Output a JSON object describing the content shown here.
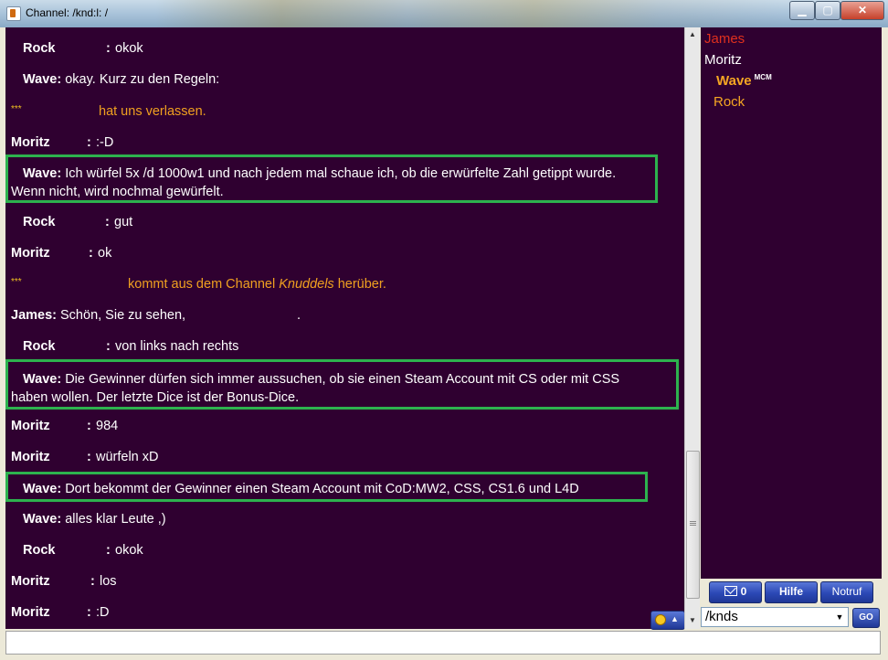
{
  "window": {
    "title": "Channel: /knd:l: /",
    "min": "▁",
    "max": "▢",
    "close": "✕"
  },
  "chat": {
    "messages": [
      {
        "sender": "Rock",
        "sep": ":",
        "text": "okok"
      },
      {
        "sender": "Wave:",
        "sep": "",
        "text": "okay. Kurz zu den Regeln:"
      },
      {
        "stars": "***",
        "text": "hat uns verlassen."
      },
      {
        "sender": "Moritz",
        "sep": ":",
        "text": ":-D"
      },
      {
        "sender": "Wave:",
        "line1": "Ich würfel 5x /d 1000w1 und nach jedem mal schaue ich, ob die erwürfelte Zahl getippt wurde.",
        "line2": "Wenn nicht, wird nochmal gewürfelt."
      },
      {
        "sender": "Rock",
        "sep": ":",
        "text": "gut"
      },
      {
        "sender": "Moritz",
        "sep": ":",
        "text": "ok"
      },
      {
        "stars": "***",
        "pre": "kommt aus dem Channel ",
        "channel": "Knuddels",
        "post": " herüber."
      },
      {
        "sender": "James:",
        "text": "Schön, Sie zu sehen,",
        "tail": "."
      },
      {
        "sender": "Rock",
        "sep": ":",
        "text": "von links nach rechts"
      },
      {
        "sender": "Wave:",
        "line1": "Die Gewinner dürfen sich immer aussuchen, ob sie einen Steam Account mit CS oder mit CSS",
        "line2": "haben wollen. Der letzte Dice ist der Bonus-Dice."
      },
      {
        "sender": "Moritz",
        "sep": ":",
        "text": "984"
      },
      {
        "sender": "Moritz",
        "sep": ":",
        "text": "würfeln xD"
      },
      {
        "sender": "Wave:",
        "text": "Dort bekommt der Gewinner einen Steam Account mit CoD:MW2, CSS, CS1.6 und L4D"
      },
      {
        "sender": "Wave:",
        "text": "alles klar Leute ,)"
      },
      {
        "sender": "Rock",
        "sep": ":",
        "text": "okok"
      },
      {
        "sender": "Moritz",
        "sep": ":",
        "text": "los"
      },
      {
        "sender": "Moritz",
        "sep": ":",
        "text": ":D"
      }
    ]
  },
  "users": [
    {
      "name": "James",
      "color": "#e0301e"
    },
    {
      "name": "Moritz",
      "color": "#ffffff"
    },
    {
      "name": "Wave",
      "badge": "MCM",
      "color": "#f5a623"
    },
    {
      "name": "Rock",
      "color": "#f5a623"
    }
  ],
  "buttons": {
    "mail_count": "0",
    "help": "Hilfe",
    "emergency": "Notruf",
    "go": "GO"
  },
  "channel_select": {
    "value": "/knds"
  },
  "colors": {
    "chat_bg": "#2f0030",
    "highlight_border": "#2db24e",
    "system_text": "#f0a020"
  }
}
